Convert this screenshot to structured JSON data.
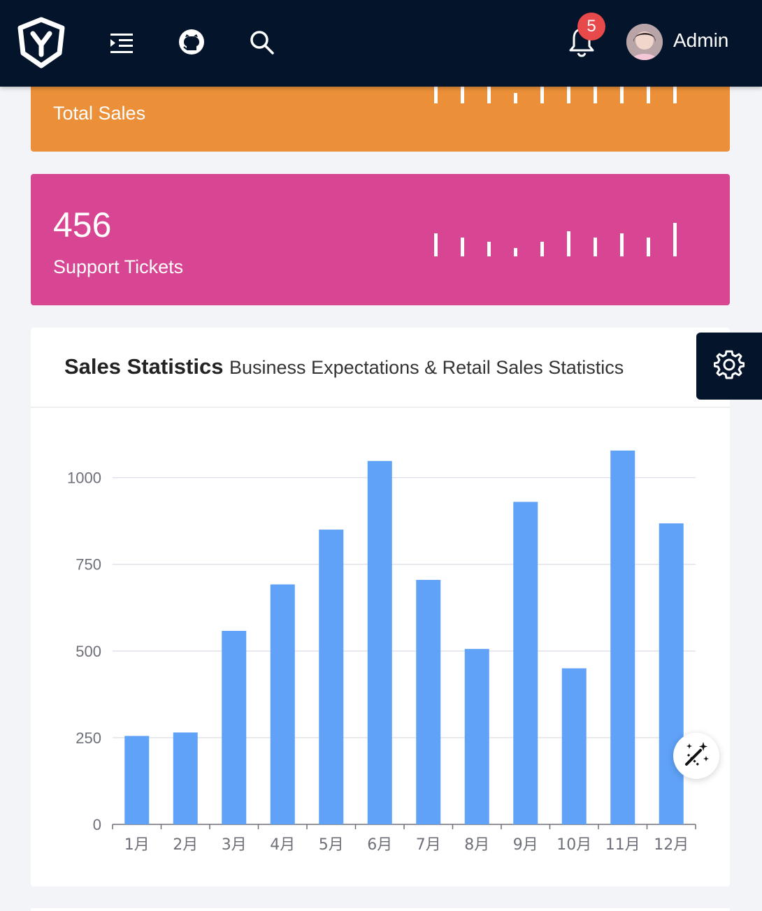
{
  "header": {
    "logo_icon": "y-shield-logo-icon",
    "menu_icon": "menu-indent-icon",
    "github_icon": "github-icon",
    "search_icon": "search-icon",
    "bell_icon": "bell-icon",
    "notification_count": "5",
    "user_name": "Admin"
  },
  "cards": [
    {
      "value": "",
      "label": "Total Sales",
      "color": "#eb9038",
      "spark": [
        0.55,
        0.45,
        0.4,
        0.25,
        0.4,
        0.55,
        0.5,
        0.6,
        0.55,
        0.8
      ]
    },
    {
      "value": "456",
      "label": "Support Tickets",
      "color": "#d84592",
      "spark": [
        0.55,
        0.45,
        0.35,
        0.2,
        0.35,
        0.6,
        0.45,
        0.55,
        0.45,
        0.8
      ]
    }
  ],
  "panel": {
    "title": "Sales Statistics",
    "subtitle": "Business Expectations & Retail Sales Statistics"
  },
  "settings_icon": "gear-icon",
  "fab_icon": "magic-wand-icon",
  "chart_data": {
    "type": "bar",
    "categories": [
      "1月",
      "2月",
      "3月",
      "4月",
      "5月",
      "6月",
      "7月",
      "8月",
      "9月",
      "10月",
      "11月",
      "12月"
    ],
    "values": [
      255,
      265,
      558,
      692,
      850,
      1048,
      705,
      506,
      930,
      450,
      1078,
      868
    ],
    "ylim": [
      0,
      1100
    ],
    "yticks": [
      0,
      250,
      500,
      750,
      1000
    ],
    "grid": true,
    "bar_color": "#5fa2f7"
  }
}
